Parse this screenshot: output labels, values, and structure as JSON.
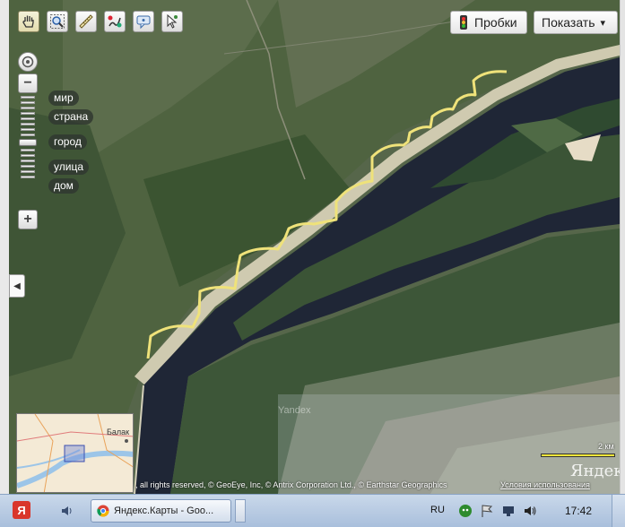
{
  "toolbar": {
    "tools": [
      {
        "name": "hand-tool",
        "icon": "hand-icon",
        "active": true
      },
      {
        "name": "zoom-area-tool",
        "icon": "magnifier-icon"
      },
      {
        "name": "ruler-tool",
        "icon": "ruler-icon"
      },
      {
        "name": "route-tool",
        "icon": "route-icon"
      },
      {
        "name": "feedback-tool",
        "icon": "speech-bubble-icon"
      },
      {
        "name": "select-tool",
        "icon": "cursor-icon"
      }
    ]
  },
  "top_right": {
    "traffic_label": "Пробки",
    "show_label": "Показать",
    "show_arrow": "▾"
  },
  "zoom": {
    "labels": [
      "мир",
      "страна",
      "город",
      "улица",
      "дом"
    ],
    "plus": "+",
    "minus": "−"
  },
  "minimap": {
    "label": "Балак"
  },
  "map": {
    "copyright": ", all rights reserved, © GeoEye, Inc, © Antrix Corporation Ltd., © Earthstar Geographics",
    "terms": "Условия использования",
    "scale": "2 км",
    "logo": "Яндекс",
    "watermark": "Yandex",
    "highlight_color": "#efe27a",
    "river_color": "#1e2536"
  },
  "taskbar": {
    "start_label": "Я",
    "task_label": "Яндекс.Карты - Goo...",
    "lang": "RU",
    "clock": "17:42"
  }
}
